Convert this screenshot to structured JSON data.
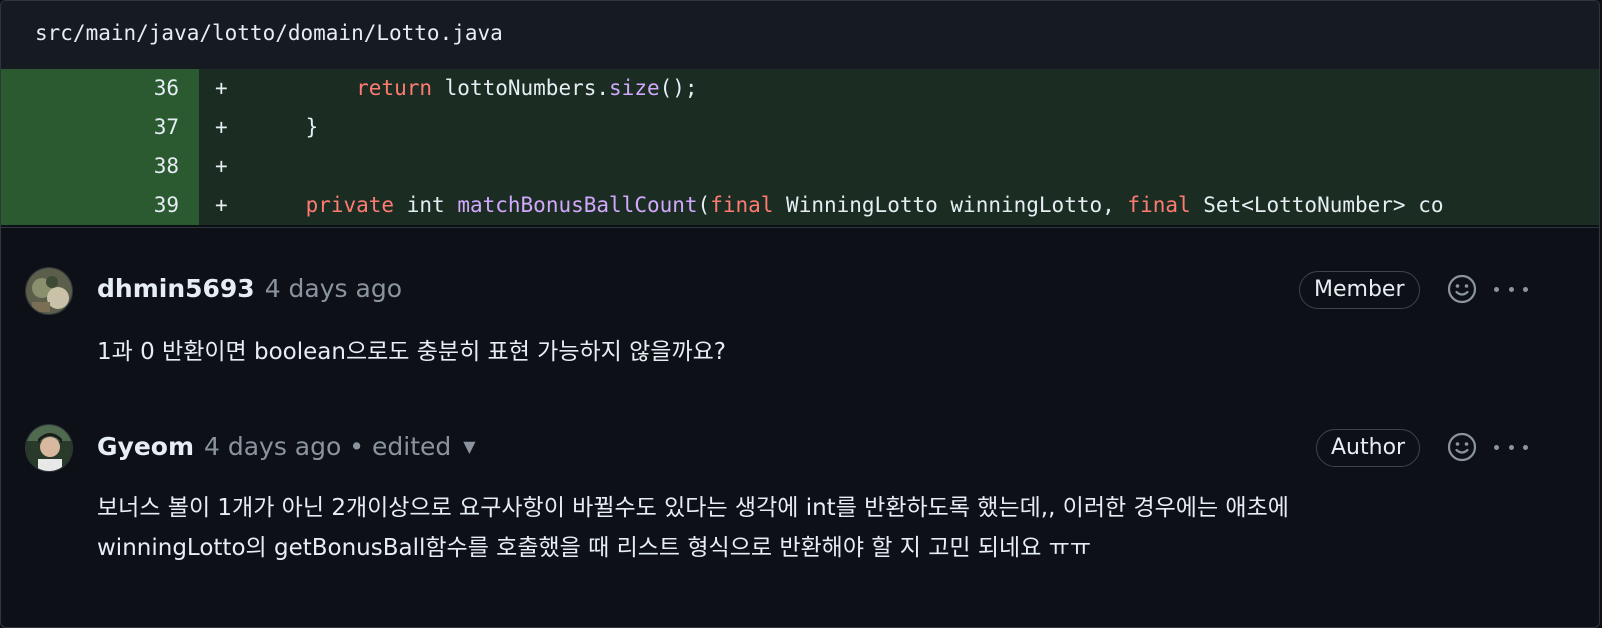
{
  "file": {
    "path": "src/main/java/lotto/domain/Lotto.java"
  },
  "diff": {
    "lines": [
      {
        "number": "36",
        "marker": "+",
        "tokens": [
          {
            "t": "        ",
            "c": "plain"
          },
          {
            "t": "return",
            "c": "kw"
          },
          {
            "t": " lottoNumbers.",
            "c": "plain"
          },
          {
            "t": "size",
            "c": "fn"
          },
          {
            "t": "();",
            "c": "plain"
          }
        ]
      },
      {
        "number": "37",
        "marker": "+",
        "tokens": [
          {
            "t": "    }",
            "c": "plain"
          }
        ]
      },
      {
        "number": "38",
        "marker": "+",
        "tokens": []
      },
      {
        "number": "39",
        "marker": "+",
        "tokens": [
          {
            "t": "    ",
            "c": "plain"
          },
          {
            "t": "private",
            "c": "kw"
          },
          {
            "t": " int ",
            "c": "plain"
          },
          {
            "t": "matchBonusBallCount",
            "c": "fn"
          },
          {
            "t": "(",
            "c": "plain"
          },
          {
            "t": "final",
            "c": "kw"
          },
          {
            "t": " WinningLotto winningLotto, ",
            "c": "plain"
          },
          {
            "t": "final",
            "c": "kw"
          },
          {
            "t": " Set<LottoNumber> co",
            "c": "plain"
          }
        ]
      }
    ]
  },
  "comments": [
    {
      "author": "dhmin5693",
      "time": "4 days ago",
      "edited": "",
      "role": "Member",
      "body": [
        "1과 0 반환이면 boolean으로도 충분히 표현 가능하지 않을까요?"
      ]
    },
    {
      "author": "Gyeom",
      "time": "4 days ago",
      "edited": "edited",
      "role": "Author",
      "body": [
        "보너스 볼이 1개가 아닌 2개이상으로 요구사항이 바뀔수도 있다는 생각에 int를 반환하도록 했는데,, 이러한 경우에는 애초에",
        "winningLotto의 getBonusBall함수를 호출했을 때 리스트 형식으로 반환해야 할 지 고민 되네요 ㅠㅠ"
      ]
    }
  ],
  "icons": {
    "reaction": "smiley-icon",
    "menu": "kebab-menu-icon",
    "edited_menu": "chevron-down-icon"
  },
  "colors": {
    "background": "#0d1117",
    "added_gutter": "#2b5930",
    "added_line": "#1b2d22",
    "keyword": "#ff7b72",
    "function": "#d2a8ff",
    "muted": "#8b949e"
  }
}
